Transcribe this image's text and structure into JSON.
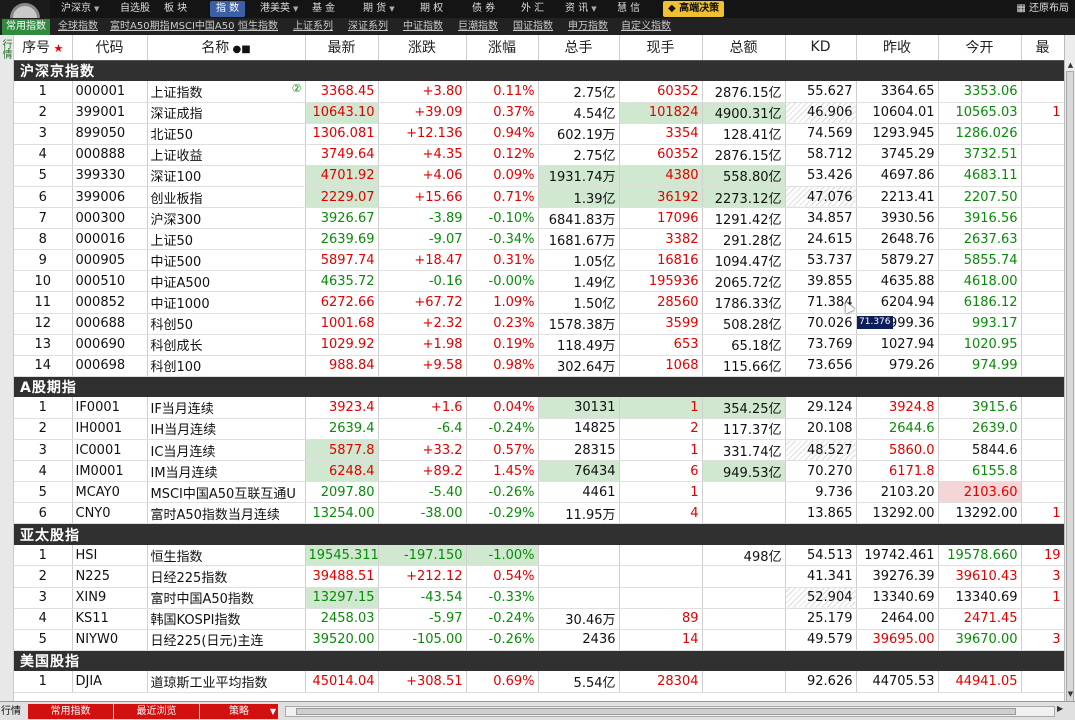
{
  "topbar": {
    "menu": [
      {
        "label": "沪深京",
        "arrow": true
      },
      {
        "label": "自选股",
        "arrow": false
      },
      {
        "label": "板 块",
        "arrow": false
      },
      {
        "label": "指 数",
        "arrow": false,
        "selected": true
      },
      {
        "label": "港美英",
        "arrow": true
      },
      {
        "label": "基 金",
        "arrow": false
      },
      {
        "label": "期 货",
        "arrow": true
      },
      {
        "label": "期 权",
        "arrow": false
      },
      {
        "label": "债 券",
        "arrow": false
      },
      {
        "label": "外 汇",
        "arrow": false
      },
      {
        "label": "资 讯",
        "arrow": true
      },
      {
        "label": "慧 信",
        "arrow": false
      }
    ],
    "special": "高端决策",
    "restore": "还原布局"
  },
  "subtabs": [
    "常用指数",
    "全球指数",
    "富时A50期指",
    "MSCI中国A50",
    "恒生指数",
    "上证系列",
    "深证系列",
    "中证指数",
    "巨潮指数",
    "国证指数",
    "申万指数",
    "自定义指数"
  ],
  "left_label": "行情",
  "columns": [
    "序号",
    "代码",
    "名称",
    "最新",
    "涨跌",
    "涨幅",
    "总手",
    "现手",
    "总额",
    "KD",
    "昨收",
    "今开",
    "最"
  ],
  "sections": [
    {
      "title": "沪深京指数",
      "rows": [
        {
          "no": "1",
          "code": "000001",
          "name": "上证指数",
          "badge": "②",
          "last": "3368.45",
          "chg": "+3.80",
          "pct": "0.11%",
          "vol": "2.75亿",
          "cur": "60352",
          "amt": "2876.15亿",
          "kd": "55.627",
          "prev": "3364.65",
          "open": "3353.06",
          "hi": "",
          "dir": "up",
          "oc": "dn"
        },
        {
          "no": "2",
          "code": "399001",
          "name": "深证成指",
          "last": "10643.10",
          "chg": "+39.09",
          "pct": "0.37%",
          "vol": "4.54亿",
          "cur": "101824",
          "amt": "4900.31亿",
          "kd": "46.906",
          "prev": "10604.01",
          "open": "10565.03",
          "hi": "1",
          "dir": "up",
          "oc": "dn",
          "hl": [
            "last",
            "cur",
            "amt"
          ],
          "hatch": true
        },
        {
          "no": "3",
          "code": "899050",
          "name": "北证50",
          "last": "1306.081",
          "chg": "+12.136",
          "pct": "0.94%",
          "vol": "602.19万",
          "cur": "3354",
          "amt": "128.41亿",
          "kd": "74.569",
          "prev": "1293.945",
          "open": "1286.026",
          "hi": "",
          "dir": "up",
          "oc": "dn"
        },
        {
          "no": "4",
          "code": "000888",
          "name": "上证收益",
          "last": "3749.64",
          "chg": "+4.35",
          "pct": "0.12%",
          "vol": "2.75亿",
          "cur": "60352",
          "amt": "2876.15亿",
          "kd": "58.712",
          "prev": "3745.29",
          "open": "3732.51",
          "hi": "",
          "dir": "up",
          "oc": "dn"
        },
        {
          "no": "5",
          "code": "399330",
          "name": "深证100",
          "last": "4701.92",
          "chg": "+4.06",
          "pct": "0.09%",
          "vol": "1931.74万",
          "cur": "4380",
          "amt": "558.80亿",
          "kd": "53.426",
          "prev": "4697.86",
          "open": "4683.11",
          "hi": "",
          "dir": "up",
          "oc": "dn",
          "hl": [
            "last",
            "vol",
            "cur",
            "amt"
          ]
        },
        {
          "no": "6",
          "code": "399006",
          "name": "创业板指",
          "last": "2229.07",
          "chg": "+15.66",
          "pct": "0.71%",
          "vol": "1.39亿",
          "cur": "36192",
          "amt": "2273.12亿",
          "kd": "47.076",
          "prev": "2213.41",
          "open": "2207.50",
          "hi": "",
          "dir": "up",
          "oc": "dn",
          "hl": [
            "last",
            "vol",
            "cur",
            "amt"
          ],
          "hatch": true
        },
        {
          "no": "7",
          "code": "000300",
          "name": "沪深300",
          "last": "3926.67",
          "chg": "-3.89",
          "pct": "-0.10%",
          "vol": "6841.83万",
          "cur": "17096",
          "amt": "1291.42亿",
          "kd": "34.857",
          "prev": "3930.56",
          "open": "3916.56",
          "hi": "",
          "dir": "dn",
          "oc": "dn"
        },
        {
          "no": "8",
          "code": "000016",
          "name": "上证50",
          "last": "2639.69",
          "chg": "-9.07",
          "pct": "-0.34%",
          "vol": "1681.67万",
          "cur": "3382",
          "amt": "291.28亿",
          "kd": "24.615",
          "prev": "2648.76",
          "open": "2637.63",
          "hi": "",
          "dir": "dn",
          "oc": "dn"
        },
        {
          "no": "9",
          "code": "000905",
          "name": "中证500",
          "last": "5897.74",
          "chg": "+18.47",
          "pct": "0.31%",
          "vol": "1.05亿",
          "cur": "16816",
          "amt": "1094.47亿",
          "kd": "53.737",
          "prev": "5879.27",
          "open": "5855.74",
          "hi": "",
          "dir": "up",
          "oc": "dn"
        },
        {
          "no": "10",
          "code": "000510",
          "name": "中证A500",
          "last": "4635.72",
          "chg": "-0.16",
          "pct": "-0.00%",
          "vol": "1.49亿",
          "cur": "195936",
          "amt": "2065.72亿",
          "kd": "39.855",
          "prev": "4635.88",
          "open": "4618.00",
          "hi": "",
          "dir": "dn",
          "oc": "dn"
        },
        {
          "no": "11",
          "code": "000852",
          "name": "中证1000",
          "last": "6272.66",
          "chg": "+67.72",
          "pct": "1.09%",
          "vol": "1.50亿",
          "cur": "28560",
          "amt": "1786.33亿",
          "kd": "71.384",
          "prev": "6204.94",
          "open": "6186.12",
          "hi": "",
          "dir": "up",
          "oc": "dn"
        },
        {
          "no": "12",
          "code": "000688",
          "name": "科创50",
          "last": "1001.68",
          "chg": "+2.32",
          "pct": "0.23%",
          "vol": "1578.38万",
          "cur": "3599",
          "amt": "508.28亿",
          "kd": "70.026",
          "prev": "999.36",
          "open": "993.17",
          "hi": "",
          "dir": "up",
          "oc": "dn"
        },
        {
          "no": "13",
          "code": "000690",
          "name": "科创成长",
          "last": "1029.92",
          "chg": "+1.98",
          "pct": "0.19%",
          "vol": "118.49万",
          "cur": "653",
          "amt": "65.18亿",
          "kd": "73.769",
          "prev": "1027.94",
          "open": "1020.95",
          "hi": "",
          "dir": "up",
          "oc": "dn"
        },
        {
          "no": "14",
          "code": "000698",
          "name": "科创100",
          "last": "988.84",
          "chg": "+9.58",
          "pct": "0.98%",
          "vol": "302.64万",
          "cur": "1068",
          "amt": "115.66亿",
          "kd": "73.656",
          "prev": "979.26",
          "open": "974.99",
          "hi": "",
          "dir": "up",
          "oc": "dn"
        }
      ]
    },
    {
      "title": "A股期指",
      "rows": [
        {
          "no": "1",
          "code": "IF0001",
          "name": "IF当月连续",
          "last": "3923.4",
          "chg": "+1.6",
          "pct": "0.04%",
          "vol": "30131",
          "cur": "1",
          "amt": "354.25亿",
          "kd": "29.124",
          "prev": "3924.8",
          "open": "3915.6",
          "hi": "",
          "dir": "up",
          "oc": "dn",
          "prevc": "red",
          "hl": [
            "vol",
            "cur",
            "amt"
          ]
        },
        {
          "no": "2",
          "code": "IH0001",
          "name": "IH当月连续",
          "last": "2639.4",
          "chg": "-6.4",
          "pct": "-0.24%",
          "vol": "14825",
          "cur": "2",
          "amt": "117.37亿",
          "kd": "20.108",
          "prev": "2644.6",
          "open": "2639.0",
          "hi": "",
          "dir": "dn",
          "oc": "dn",
          "prevc": "grn"
        },
        {
          "no": "3",
          "code": "IC0001",
          "name": "IC当月连续",
          "last": "5877.8",
          "chg": "+33.2",
          "pct": "0.57%",
          "vol": "28315",
          "cur": "1",
          "amt": "331.74亿",
          "kd": "48.527",
          "prev": "5860.0",
          "open": "5844.6",
          "hi": "",
          "dir": "up",
          "oc": "blk",
          "prevc": "red",
          "hl": [
            "last"
          ],
          "hatch": true
        },
        {
          "no": "4",
          "code": "IM0001",
          "name": "IM当月连续",
          "last": "6248.4",
          "chg": "+89.2",
          "pct": "1.45%",
          "vol": "76434",
          "cur": "6",
          "amt": "949.53亿",
          "kd": "70.270",
          "prev": "6171.8",
          "open": "6155.8",
          "hi": "",
          "dir": "up",
          "oc": "dn",
          "prevc": "red",
          "hl": [
            "last",
            "vol",
            "amt"
          ]
        },
        {
          "no": "5",
          "code": "MCAY0",
          "name": "MSCI中国A50互联互通U",
          "last": "2097.80",
          "chg": "-5.40",
          "pct": "-0.26%",
          "vol": "4461",
          "cur": "1",
          "amt": "",
          "kd": "9.736",
          "prev": "2103.20",
          "open": "2103.60",
          "hi": "",
          "dir": "dn",
          "oc": "up",
          "prevc": "blk",
          "openhl": true
        },
        {
          "no": "6",
          "code": "CNY0",
          "name": "富时A50指数当月连续",
          "last": "13254.00",
          "chg": "-38.00",
          "pct": "-0.29%",
          "vol": "11.95万",
          "cur": "4",
          "amt": "",
          "kd": "13.865",
          "prev": "13292.00",
          "open": "13292.00",
          "hi": "1",
          "dir": "dn",
          "oc": "blk",
          "prevc": "blk"
        }
      ]
    },
    {
      "title": "亚太股指",
      "rows": [
        {
          "no": "1",
          "code": "HSI",
          "name": "恒生指数",
          "last": "19545.311",
          "chg": "-197.150",
          "pct": "-1.00%",
          "vol": "",
          "cur": "",
          "amt": "498亿",
          "kd": "54.513",
          "prev": "19742.461",
          "open": "19578.660",
          "hi": "19",
          "dir": "dn",
          "oc": "dn",
          "hl": [
            "last",
            "chg",
            "pct"
          ]
        },
        {
          "no": "2",
          "code": "N225",
          "name": "日经225指数",
          "last": "39488.51",
          "chg": "+212.12",
          "pct": "0.54%",
          "vol": "",
          "cur": "",
          "amt": "",
          "kd": "41.341",
          "prev": "39276.39",
          "open": "39610.43",
          "hi": "3",
          "dir": "up",
          "oc": "up"
        },
        {
          "no": "3",
          "code": "XIN9",
          "name": "富时中国A50指数",
          "last": "13297.15",
          "chg": "-43.54",
          "pct": "-0.33%",
          "vol": "",
          "cur": "",
          "amt": "",
          "kd": "52.904",
          "prev": "13340.69",
          "open": "13340.69",
          "hi": "1",
          "dir": "dn",
          "oc": "blk",
          "hl": [
            "last"
          ],
          "hatch": true
        },
        {
          "no": "4",
          "code": "KS11",
          "name": "韩国KOSPI指数",
          "last": "2458.03",
          "chg": "-5.97",
          "pct": "-0.24%",
          "vol": "30.46万",
          "cur": "89",
          "amt": "",
          "kd": "25.179",
          "prev": "2464.00",
          "open": "2471.45",
          "hi": "",
          "dir": "dn",
          "oc": "up"
        },
        {
          "no": "5",
          "code": "NIYW0",
          "name": "日经225(日元)主连",
          "last": "39520.00",
          "chg": "-105.00",
          "pct": "-0.26%",
          "vol": "2436",
          "cur": "14",
          "amt": "",
          "kd": "49.579",
          "prev": "39695.00",
          "open": "39670.00",
          "hi": "3",
          "dir": "dn",
          "oc": "dn",
          "prevc": "red"
        }
      ]
    },
    {
      "title": "美国股指",
      "rows": [
        {
          "no": "1",
          "code": "DJIA",
          "name": "道琼斯工业平均指数",
          "last": "45014.04",
          "chg": "+308.51",
          "pct": "0.69%",
          "vol": "5.54亿",
          "cur": "28304",
          "amt": "",
          "kd": "92.626",
          "prev": "44705.53",
          "open": "44941.05",
          "hi": "",
          "dir": "up",
          "oc": "up"
        }
      ]
    }
  ],
  "tooltip": "71.376",
  "bottombar": {
    "first": "行情",
    "tabs": [
      "常用指数",
      "最近浏览",
      "策略"
    ]
  }
}
